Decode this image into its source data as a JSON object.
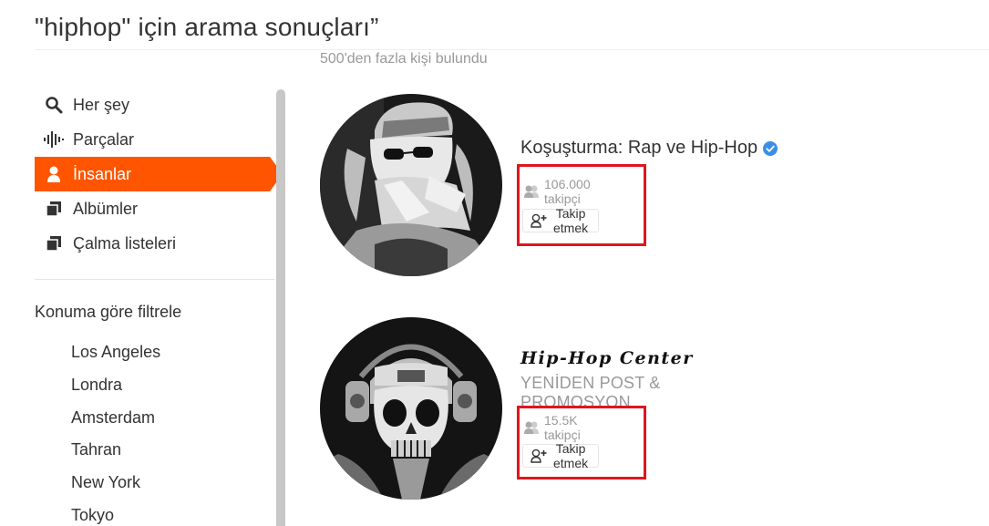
{
  "header": {
    "title": "\"hiphop\" için arama sonuçları”",
    "result_count": "500'den fazla kişi bulundu"
  },
  "sidebar": {
    "nav_items": [
      {
        "label": "Her şey",
        "icon": "search-icon"
      },
      {
        "label": "Parçalar",
        "icon": "waveform-icon"
      },
      {
        "label": "İnsanlar",
        "icon": "person-icon",
        "active": true
      },
      {
        "label": "Albümler",
        "icon": "album-icon"
      },
      {
        "label": "Çalma listeleri",
        "icon": "playlist-icon"
      }
    ],
    "filter_heading": "Konuma göre filtrele",
    "locations": [
      "Los Angeles",
      "Londra",
      "Amsterdam",
      "Tahran",
      "New York",
      "Tokyo"
    ]
  },
  "results": [
    {
      "name": "Koşuşturma: Rap ve Hip-Hop",
      "verified": true,
      "followers": "106.000 takipçi",
      "follow_label": "Takip etmek"
    },
    {
      "name": "Hip-Hop Center",
      "subtitle": "YENİDEN POST & PROMOSYON",
      "followers": "15.5K takipçi",
      "follow_label": "Takip etmek"
    }
  ],
  "colors": {
    "accent": "#ff5500",
    "verified": "#3b8ee8",
    "highlight": "#e0161c",
    "muted_text": "#999999"
  }
}
